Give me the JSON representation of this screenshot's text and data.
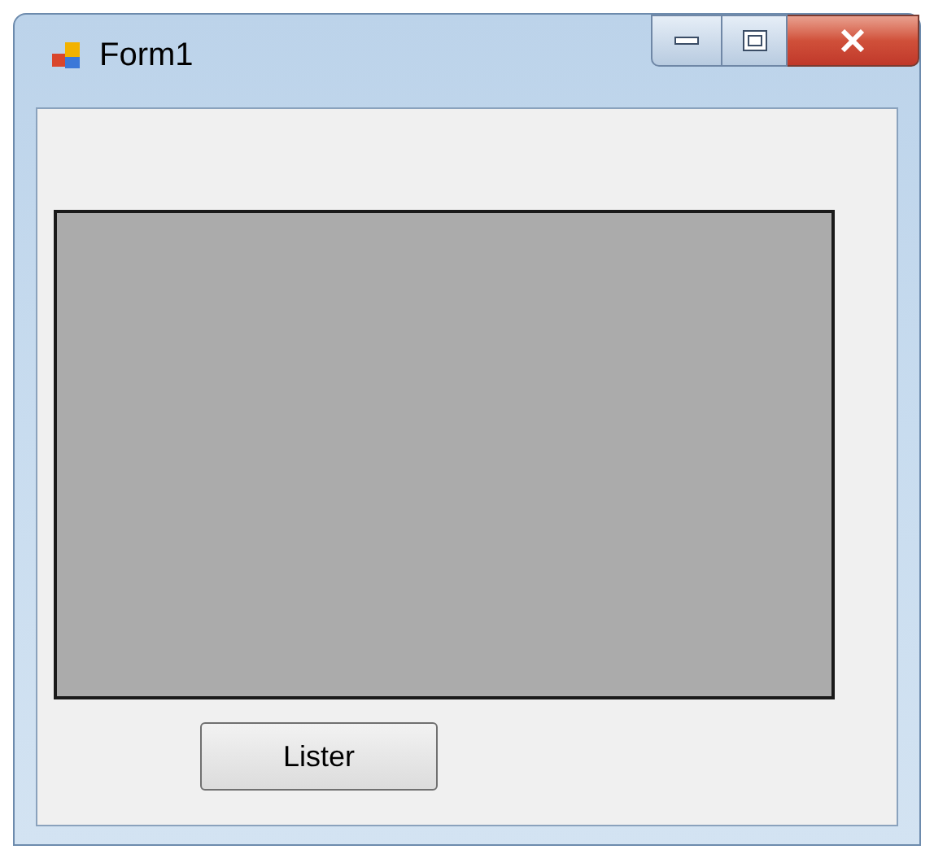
{
  "window": {
    "title": "Form1"
  },
  "buttons": [
    {
      "label": "Lister"
    }
  ]
}
